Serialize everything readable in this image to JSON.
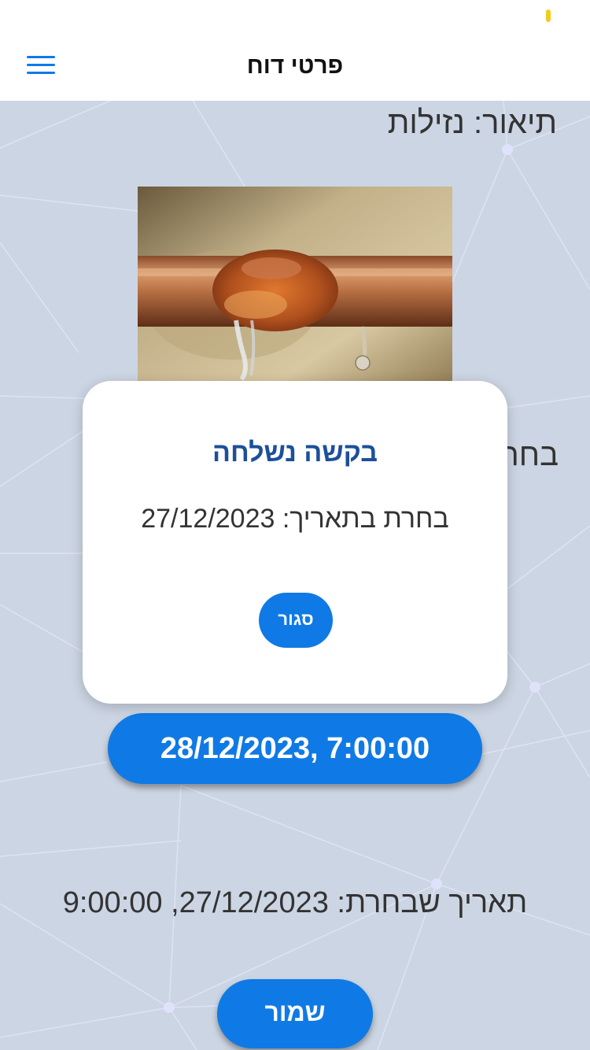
{
  "header": {
    "title": "פרטי דוח"
  },
  "report": {
    "description": "תיאור: נזילות",
    "partial_label": "בחר",
    "selected_datetime_button": "28/12/2023, 7:00:00",
    "chosen_date_text": "תאריך שבחרת: 27/12/2023, 9:00:00",
    "save_label": "שמור"
  },
  "modal": {
    "title": "בקשה נשלחה",
    "message": "בחרת בתאריך: 27/12/2023",
    "close_label": "סגור"
  },
  "colors": {
    "accent": "#0f7ae5",
    "modal_title": "#1d4f9a",
    "background": "#ccd5e3"
  },
  "icons": {
    "menu": "hamburger-menu-icon"
  }
}
